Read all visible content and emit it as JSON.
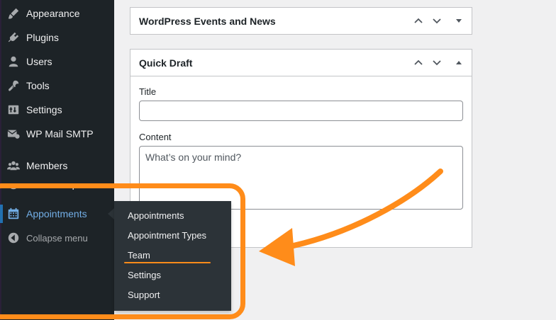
{
  "sidebar": {
    "items": [
      {
        "label": "Appearance",
        "icon": "paintbrush-icon"
      },
      {
        "label": "Plugins",
        "icon": "plugin-icon"
      },
      {
        "label": "Users",
        "icon": "user-icon"
      },
      {
        "label": "Tools",
        "icon": "wrench-icon"
      },
      {
        "label": "Settings",
        "icon": "sliders-icon"
      },
      {
        "label": "WP Mail SMTP",
        "icon": "mail-icon"
      },
      {
        "label": "Members",
        "icon": "group-icon"
      },
      {
        "label": "CLI Backup",
        "icon": "backup-icon"
      },
      {
        "label": "Appointments",
        "icon": "calendar-icon",
        "active": true
      },
      {
        "label": "Collapse menu",
        "icon": "collapse-icon"
      }
    ],
    "flyout": [
      {
        "label": "Appointments"
      },
      {
        "label": "Appointment Types"
      },
      {
        "label": "Team",
        "highlighted": true
      },
      {
        "label": "Settings"
      },
      {
        "label": "Support"
      }
    ]
  },
  "widgets": {
    "events": {
      "title": "WordPress Events and News"
    },
    "quick_draft": {
      "title": "Quick Draft",
      "title_label": "Title",
      "title_value": "",
      "content_label": "Content",
      "content_placeholder": "What’s on your mind?"
    }
  },
  "colors": {
    "sidebar_bg": "#1d2327",
    "flyout_bg": "#2c3338",
    "active_text": "#72aee6",
    "annotation": "#ff8c1a",
    "page_bg": "#f0f0f1"
  }
}
